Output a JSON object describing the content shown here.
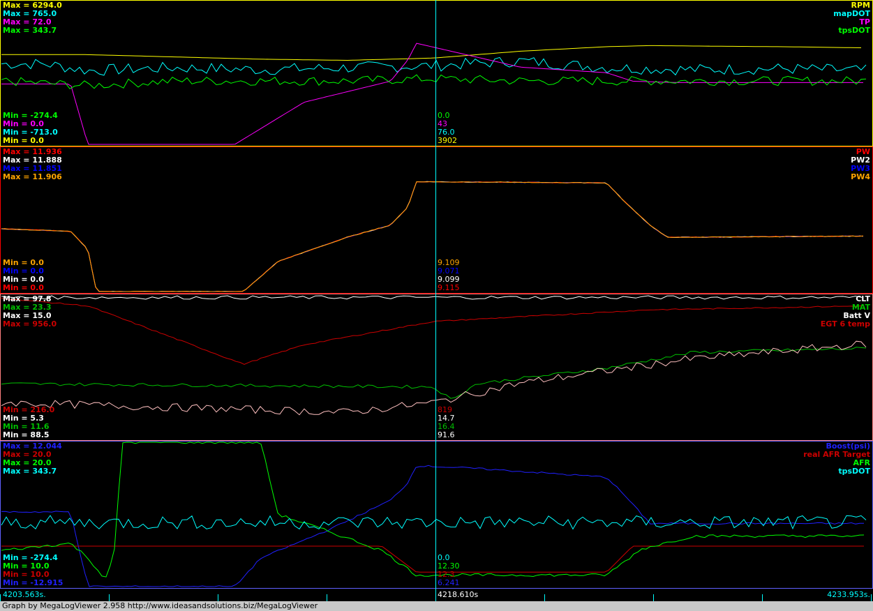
{
  "footer": {
    "credit": "Graph by MegaLogViewer 2.958 http://www.ideasandsolutions.biz/MegaLogViewer"
  },
  "time_axis": {
    "start": "4203.563s.",
    "cursor": "4218.610s",
    "end": "4233.953s."
  },
  "chart_data": [
    {
      "type": "line",
      "panel": 1,
      "border_color": "#ffff00",
      "x": [
        4203.563,
        4233.953
      ],
      "series": [
        {
          "name": "RPM",
          "color": "#ffff00",
          "max_label": "Max = 6294.0",
          "min_label": "Min = 0.0",
          "cursor_value": "3902",
          "points": [
            [
              0,
              3950
            ],
            [
              0.1,
              3950
            ],
            [
              0.2,
              3850
            ],
            [
              0.3,
              3750
            ],
            [
              0.4,
              3700
            ],
            [
              0.5,
              3800
            ],
            [
              0.6,
              4100
            ],
            [
              0.7,
              4300
            ],
            [
              0.75,
              4350
            ],
            [
              0.8,
              4330
            ],
            [
              0.9,
              4300
            ],
            [
              1.0,
              4250
            ]
          ]
        },
        {
          "name": "mapDOT",
          "color": "#00ffff",
          "max_label": "Max = 765.0",
          "min_label": "Min = -713.0",
          "cursor_value": "76.0",
          "points": [
            [
              0,
              120
            ],
            [
              0.05,
              120
            ],
            [
              0.1,
              50
            ],
            [
              0.2,
              80
            ],
            [
              0.3,
              60
            ],
            [
              0.4,
              80
            ],
            [
              0.5,
              100
            ],
            [
              0.6,
              150
            ],
            [
              0.7,
              80
            ],
            [
              0.8,
              60
            ],
            [
              0.9,
              70
            ],
            [
              1.0,
              50
            ]
          ]
        },
        {
          "name": "TP",
          "color": "#ff00ff",
          "max_label": "Max = 72.0",
          "min_label": "Min = 0.0",
          "cursor_value": "43",
          "points": [
            [
              0,
              43
            ],
            [
              0.08,
              43
            ],
            [
              0.1,
              0
            ],
            [
              0.27,
              0
            ],
            [
              0.35,
              30
            ],
            [
              0.45,
              45
            ],
            [
              0.47,
              60
            ],
            [
              0.48,
              72
            ],
            [
              0.6,
              55
            ],
            [
              0.7,
              51
            ],
            [
              0.73,
              45
            ],
            [
              0.78,
              44
            ],
            [
              0.95,
              44
            ],
            [
              1.0,
              44
            ]
          ]
        },
        {
          "name": "tpsDOT",
          "color": "#00ff00",
          "max_label": "Max = 343.7",
          "min_label": "Min = -274.4",
          "cursor_value": "0.0",
          "points": [
            [
              0,
              0
            ],
            [
              0.1,
              -20
            ],
            [
              0.2,
              0
            ],
            [
              0.4,
              0
            ],
            [
              0.5,
              10
            ],
            [
              0.6,
              0
            ],
            [
              0.8,
              0
            ],
            [
              1.0,
              0
            ]
          ]
        }
      ]
    },
    {
      "type": "line",
      "panel": 2,
      "border_color": "#ff0000",
      "x": [
        4203.563,
        4233.953
      ],
      "series": [
        {
          "name": "PW",
          "color": "#ff0000",
          "max_label": "Max = 11.936",
          "min_label": "Min = 0.0",
          "cursor_value": "9.115"
        },
        {
          "name": "PW2",
          "color": "#ffffff",
          "max_label": "Max = 11.888",
          "min_label": "Min = 0.0",
          "cursor_value": "9.099"
        },
        {
          "name": "PW3",
          "color": "#0000ff",
          "max_label": "Max = 11.851",
          "min_label": "Min = 0.0",
          "cursor_value": "9.071"
        },
        {
          "name": "PW4",
          "color": "#ffa500",
          "max_label": "Max = 11.906",
          "min_label": "Min = 0.0",
          "cursor_value": "9.109",
          "points": [
            [
              0,
              5.2
            ],
            [
              0.08,
              5.0
            ],
            [
              0.1,
              3.5
            ],
            [
              0.11,
              0
            ],
            [
              0.28,
              0
            ],
            [
              0.32,
              2.5
            ],
            [
              0.4,
              4.5
            ],
            [
              0.45,
              5.5
            ],
            [
              0.47,
              7.0
            ],
            [
              0.48,
              9.1
            ],
            [
              0.7,
              9.0
            ],
            [
              0.72,
              7.5
            ],
            [
              0.75,
              5.5
            ],
            [
              0.77,
              4.5
            ],
            [
              0.8,
              4.5
            ],
            [
              1.0,
              4.6
            ]
          ]
        }
      ]
    },
    {
      "type": "line",
      "panel": 3,
      "border_color": "#ff8080",
      "x": [
        4203.563,
        4233.953
      ],
      "series": [
        {
          "name": "CLT",
          "color": "#ffffff",
          "max_label": "Max = 97.8",
          "min_label": "Min = 88.5",
          "cursor_value": "91.6"
        },
        {
          "name": "MAT",
          "color": "#00c000",
          "max_label": "Max = 23.3",
          "min_label": "Min = 11.6",
          "cursor_value": "16.4"
        },
        {
          "name": "Batt V",
          "color": "#ffffff",
          "max_label": "Max = 15.0",
          "min_label": "Min = 5.3",
          "cursor_value": "14.7"
        },
        {
          "name": "EGT 6 temp",
          "color": "#cc0000",
          "max_label": "Max = 956.0",
          "min_label": "Min = 216.0",
          "cursor_value": "819"
        }
      ]
    },
    {
      "type": "line",
      "panel": 4,
      "border_color": "#6060ff",
      "x": [
        4203.563,
        4233.953
      ],
      "series": [
        {
          "name": "Boost(psi)",
          "color": "#2020ff",
          "max_label": "Max = 12.044",
          "min_label": "Min = -12.915",
          "cursor_value": "6.241"
        },
        {
          "name": "real AFR Target",
          "color": "#cc0000",
          "max_label": "Max = 20.0",
          "min_label": "Min = 10.0",
          "cursor_value": "12.3"
        },
        {
          "name": "AFR",
          "color": "#00ff00",
          "max_label": "Max = 20.0",
          "min_label": "Min = 10.0",
          "cursor_value": "12.30"
        },
        {
          "name": "tpsDOT",
          "color": "#00ffff",
          "max_label": "Max = 343.7",
          "min_label": "Min = -274.4",
          "cursor_value": "0.0"
        }
      ]
    }
  ]
}
